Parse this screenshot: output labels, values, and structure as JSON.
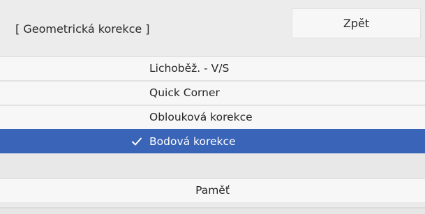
{
  "header": {
    "title": "[ Geometrická korekce ]",
    "back_label": "Zpět"
  },
  "menu": {
    "items": [
      {
        "label": "Lichoběž. - V/S",
        "selected": false
      },
      {
        "label": "Quick Corner",
        "selected": false
      },
      {
        "label": "Oblouková korekce",
        "selected": false
      },
      {
        "label": "Bodová korekce",
        "selected": true,
        "icon": "checkmark-icon"
      }
    ],
    "memory_label": "Paměť"
  },
  "colors": {
    "background": "#ebebeb",
    "row": "#f7f7f7",
    "selected": "#3a64b8",
    "selected_text": "#ffffff"
  }
}
